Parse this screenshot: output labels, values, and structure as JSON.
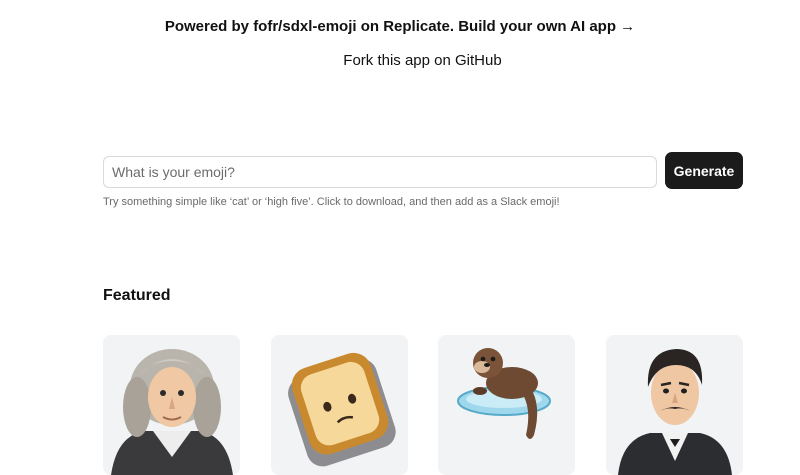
{
  "header": {
    "powered_by": "Powered by fofr/sdxl-emoji on Replicate. Build your own AI app →",
    "fork_link": "Fork this app on GitHub"
  },
  "search": {
    "placeholder": "What is your emoji?",
    "value": "",
    "button_label": "Generate",
    "hint": "Try something simple like ‘cat’ or ‘high five’. Click to download, and then add as a Slack emoji!"
  },
  "featured": {
    "title": "Featured",
    "items": [
      {
        "icon": "scientist-curly-hair-emoji-icon"
      },
      {
        "icon": "toast-face-emoji-icon"
      },
      {
        "icon": "otter-on-ice-emoji-icon"
      },
      {
        "icon": "man-with-mustache-emoji-icon"
      }
    ]
  }
}
